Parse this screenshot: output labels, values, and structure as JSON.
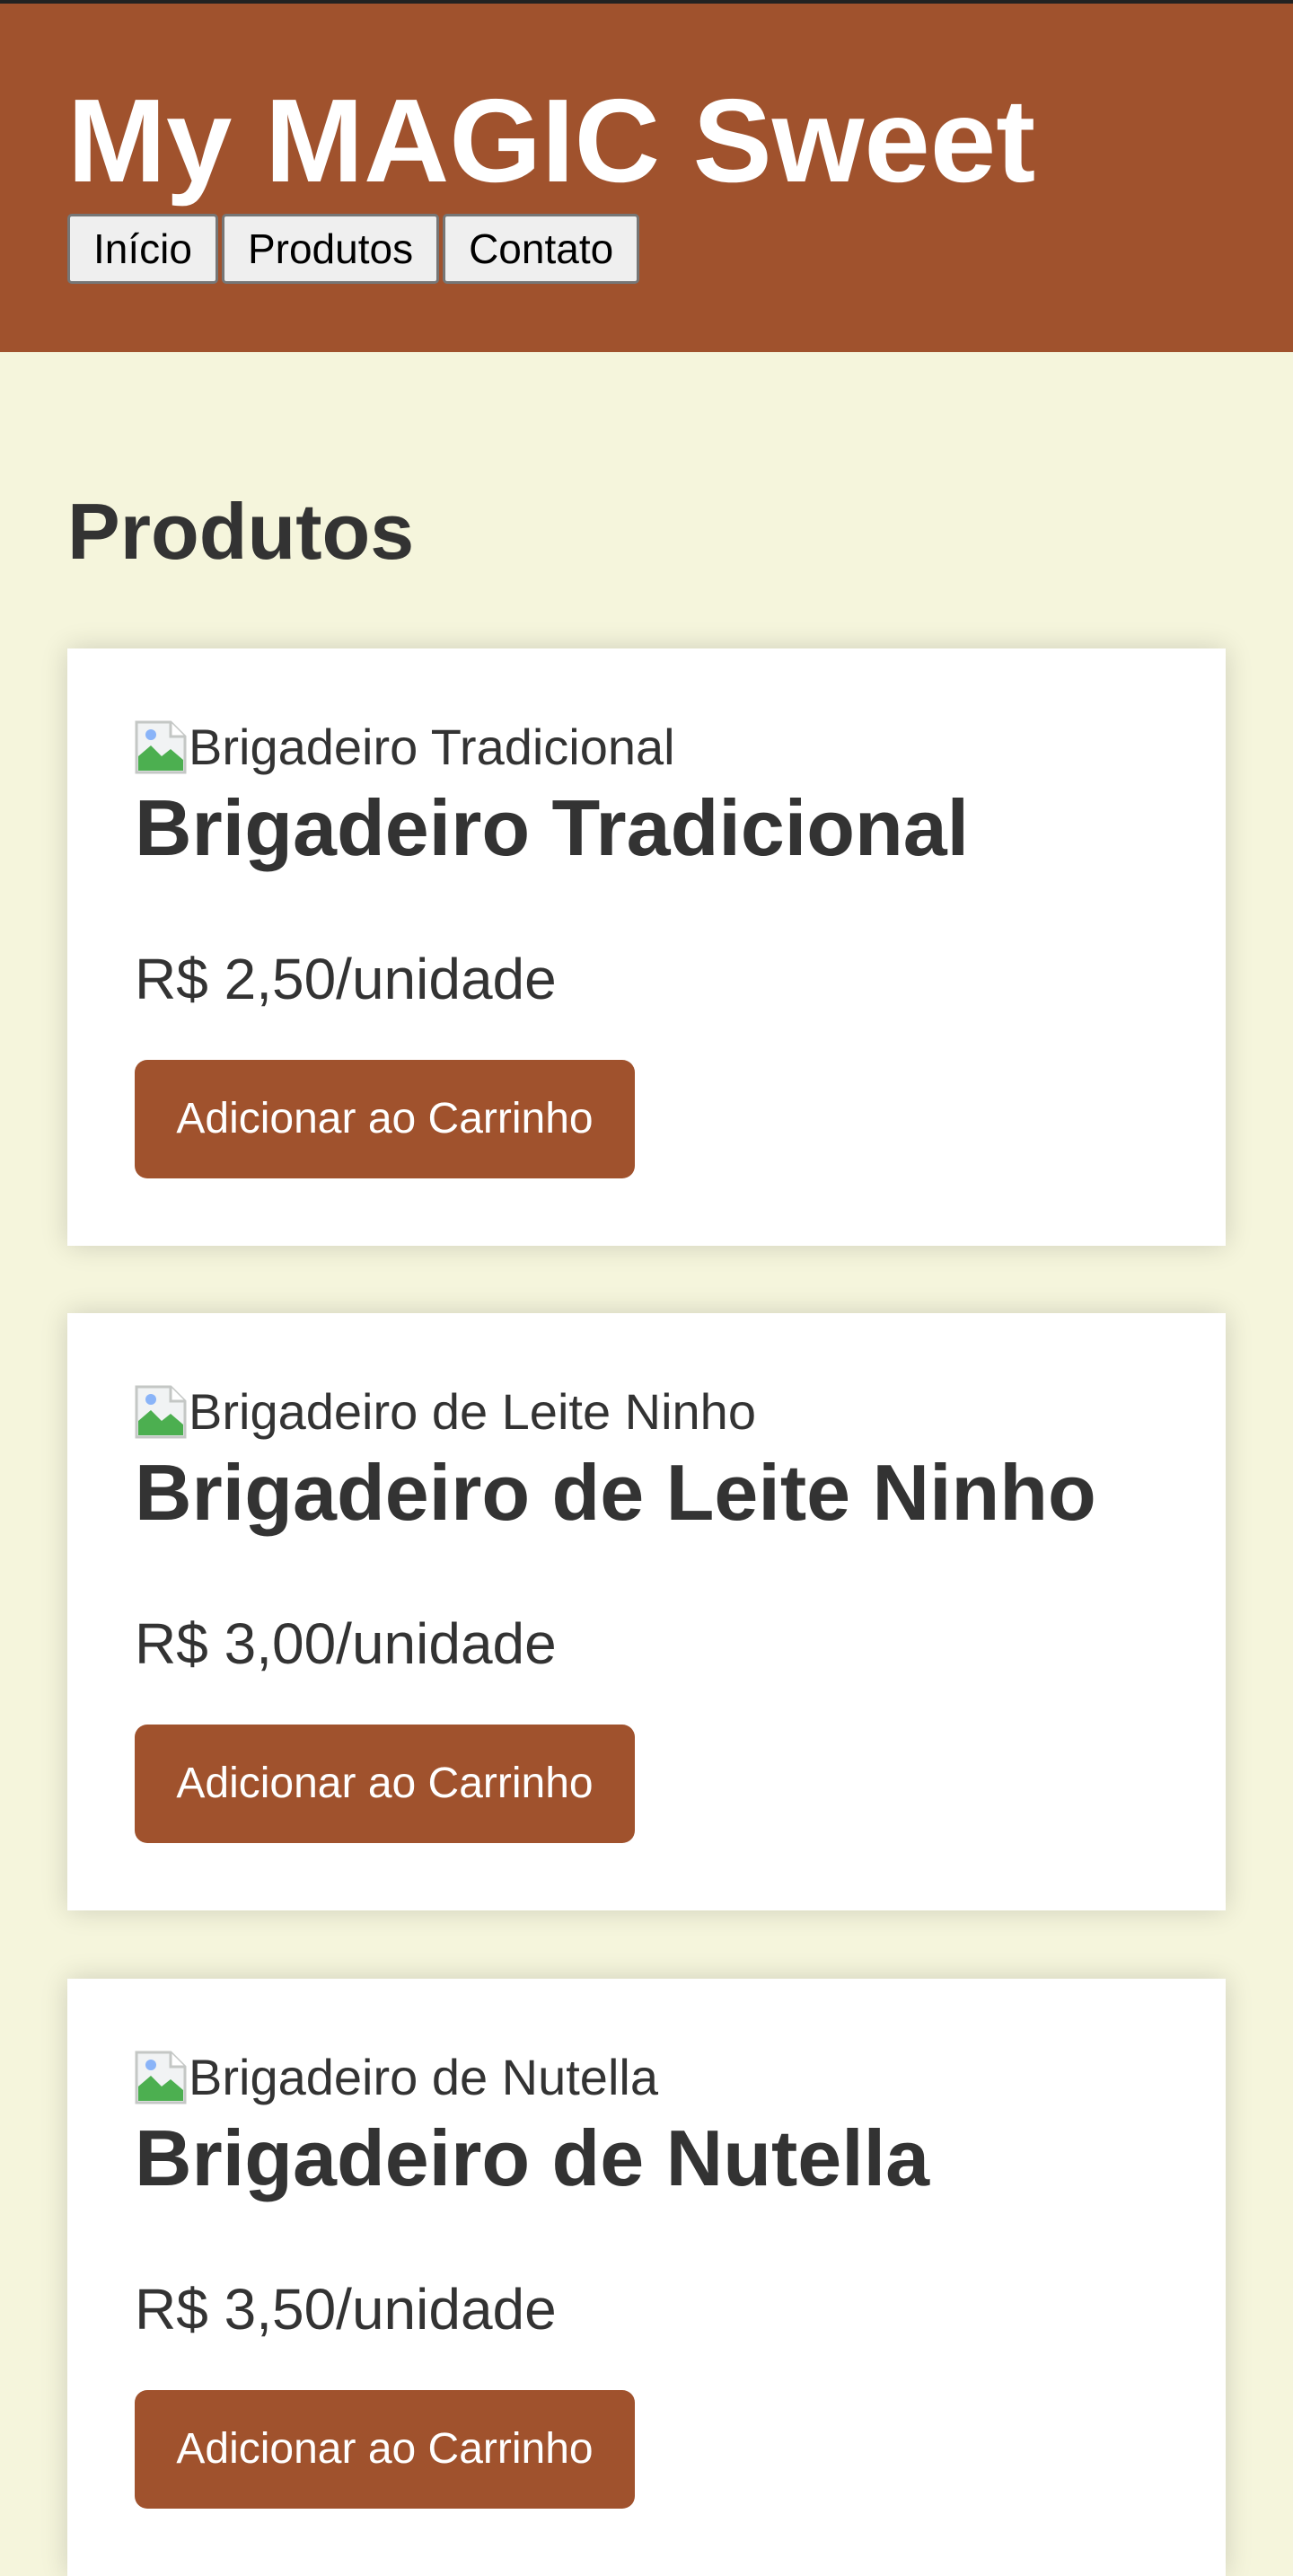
{
  "header": {
    "title": "My MAGIC Sweet",
    "nav": [
      "Início",
      "Produtos",
      "Contato"
    ]
  },
  "main": {
    "section_title": "Produtos",
    "products": [
      {
        "image_alt": "Brigadeiro Tradicional",
        "name": "Brigadeiro Tradicional",
        "price": "R$ 2,50/unidade",
        "button": "Adicionar ao Carrinho"
      },
      {
        "image_alt": "Brigadeiro de Leite Ninho",
        "name": "Brigadeiro de Leite Ninho",
        "price": "R$ 3,00/unidade",
        "button": "Adicionar ao Carrinho"
      },
      {
        "image_alt": "Brigadeiro de Nutella",
        "name": "Brigadeiro de Nutella",
        "price": "R$ 3,50/unidade",
        "button": "Adicionar ao Carrinho"
      }
    ]
  },
  "colors": {
    "brand": "#a0522d",
    "background": "#f5f5dc",
    "card": "#ffffff",
    "text": "#333333"
  }
}
